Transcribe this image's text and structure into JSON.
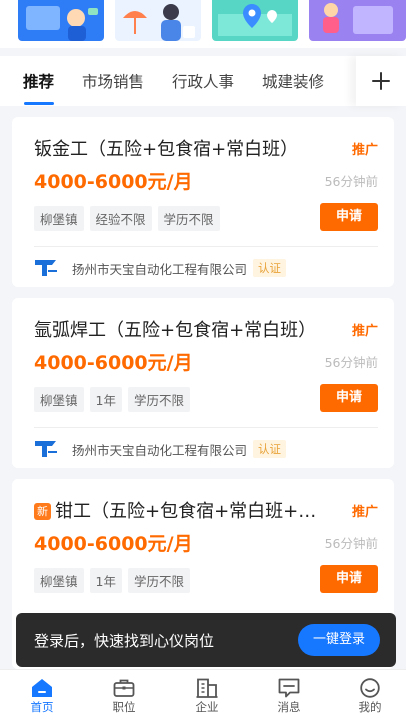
{
  "banners": [
    "banner-1",
    "banner-2",
    "banner-3",
    "banner-4"
  ],
  "tabs": [
    {
      "label": "推荐",
      "active": true
    },
    {
      "label": "市场销售",
      "active": false
    },
    {
      "label": "行政人事",
      "active": false
    },
    {
      "label": "城建装修",
      "active": false
    }
  ],
  "tab_add_icon": "plus-icon",
  "jobs": [
    {
      "title": "钣金工（五险+包食宿+常白班）",
      "promo": "推广",
      "salary": "4000-6000元/月",
      "time": "56分钟前",
      "tags": [
        "柳堡镇",
        "经验不限",
        "学历不限"
      ],
      "apply_label": "申请",
      "company": "扬州市天宝自动化工程有限公司",
      "verified": "认证"
    },
    {
      "title": "氩弧焊工（五险+包食宿+常白班）",
      "promo": "推广",
      "salary": "4000-6000元/月",
      "time": "56分钟前",
      "tags": [
        "柳堡镇",
        "1年",
        "学历不限"
      ],
      "apply_label": "申请",
      "company": "扬州市天宝自动化工程有限公司",
      "verified": "认证"
    },
    {
      "new_badge": "新",
      "title": "钳工（五险+包食宿+常白班+班车…",
      "promo": "推广",
      "salary": "4000-6000元/月",
      "time": "56分钟前",
      "tags": [
        "柳堡镇",
        "1年",
        "学历不限"
      ],
      "apply_label": "申请"
    }
  ],
  "login_prompt": {
    "text": "登录后，快速找到心仪岗位",
    "button": "一键登录"
  },
  "bottom_nav": [
    {
      "label": "首页",
      "icon": "home-icon",
      "active": true
    },
    {
      "label": "职位",
      "icon": "briefcase-icon",
      "active": false
    },
    {
      "label": "企业",
      "icon": "building-icon",
      "active": false
    },
    {
      "label": "消息",
      "icon": "message-icon",
      "active": false
    },
    {
      "label": "我的",
      "icon": "profile-icon",
      "active": false
    }
  ],
  "colors": {
    "accent": "#1677ff",
    "salary": "#ff6a00",
    "apply": "#ff6a00",
    "background": "#f3f5f8"
  }
}
